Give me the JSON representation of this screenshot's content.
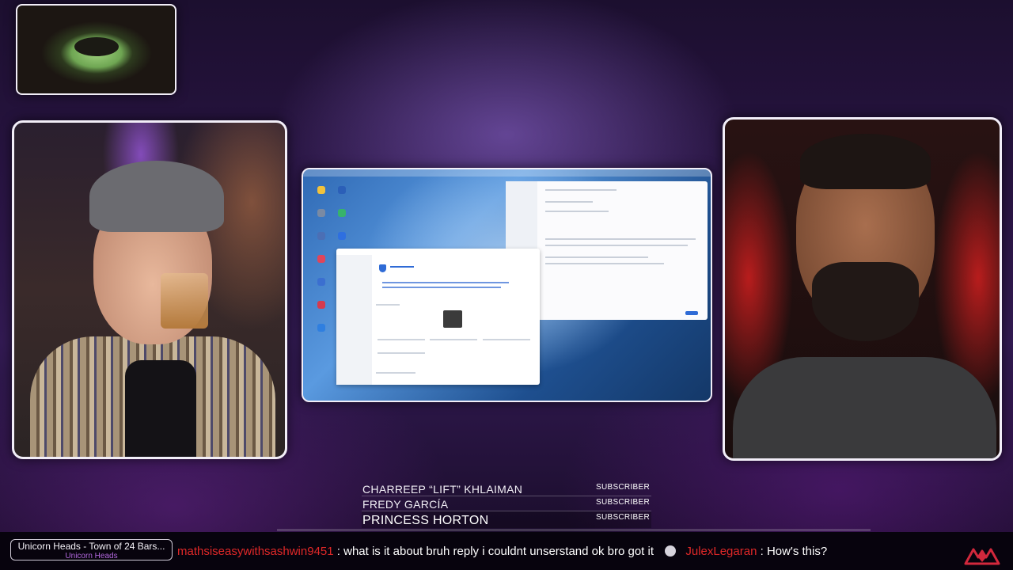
{
  "scene": {
    "cameras": [
      "small-camera",
      "left-host-camera",
      "right-host-camera"
    ],
    "shared_screen": "nas-storage-settings"
  },
  "credits": [
    {
      "name": "CHARREEP “LIFT” KHLAIMAN",
      "tag": "SUBSCRIBER",
      "highlighted": false
    },
    {
      "name": "FREDY GARCÍA",
      "tag": "SUBSCRIBER",
      "highlighted": false
    },
    {
      "name": "PRINCESS HORTON",
      "tag": "SUBSCRIBER",
      "highlighted": true
    }
  ],
  "now_playing": {
    "title": "Unicorn Heads - Town of 24 Bars...",
    "artist": "Unicorn Heads"
  },
  "chat": [
    {
      "user": "mathsiseasywithsashwin9451",
      "message": "what is it about  bruh reply i couldnt unserstand  ok bro got it"
    },
    {
      "user": "JulexLegaran",
      "message": "How's this?"
    }
  ],
  "colors": {
    "accent_purple": "#b46ae0",
    "chat_user_red": "#e02828",
    "frame_border": "#f2eef8",
    "logo_red": "#d2283c"
  },
  "icons": [
    "chat-separator-icon",
    "channel-logo-icon",
    "shield-icon"
  ]
}
